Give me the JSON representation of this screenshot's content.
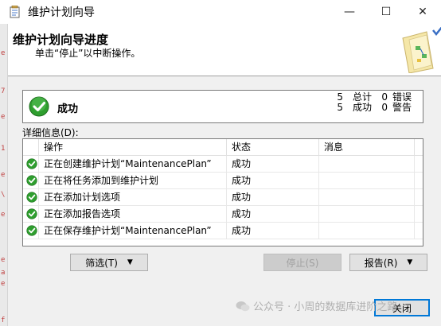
{
  "window": {
    "title": "维护计划向导",
    "minimize_label": "—",
    "maximize_label": "☐",
    "close_label": "✕"
  },
  "header": {
    "title": "维护计划向导进度",
    "subtitle": "单击“停止”以中断操作。"
  },
  "status": {
    "text": "成功",
    "total_count": "5",
    "total_label": "总计",
    "error_count": "0",
    "error_label": "错误",
    "success_count": "5",
    "success_label": "成功",
    "warning_count": "0",
    "warning_label": "警告"
  },
  "details": {
    "label": "详细信息(D):",
    "columns": [
      "操作",
      "状态",
      "消息"
    ],
    "rows": [
      {
        "action": "正在创建维护计划“MaintenancePlan”",
        "status": "成功",
        "message": ""
      },
      {
        "action": "正在将任务添加到维护计划",
        "status": "成功",
        "message": ""
      },
      {
        "action": "正在添加计划选项",
        "status": "成功",
        "message": ""
      },
      {
        "action": "正在添加报告选项",
        "status": "成功",
        "message": ""
      },
      {
        "action": "正在保存维护计划“MaintenancePlan”",
        "status": "成功",
        "message": ""
      }
    ]
  },
  "buttons": {
    "filter": "筛选(T)",
    "stop": "停止(S)",
    "report": "报告(R)",
    "close": "关闭"
  },
  "watermark": {
    "text": "公众号 · 小周的数据库进阶之路"
  },
  "colors": {
    "success_green": "#2e9e2e",
    "accent_blue": "#0078d7"
  }
}
